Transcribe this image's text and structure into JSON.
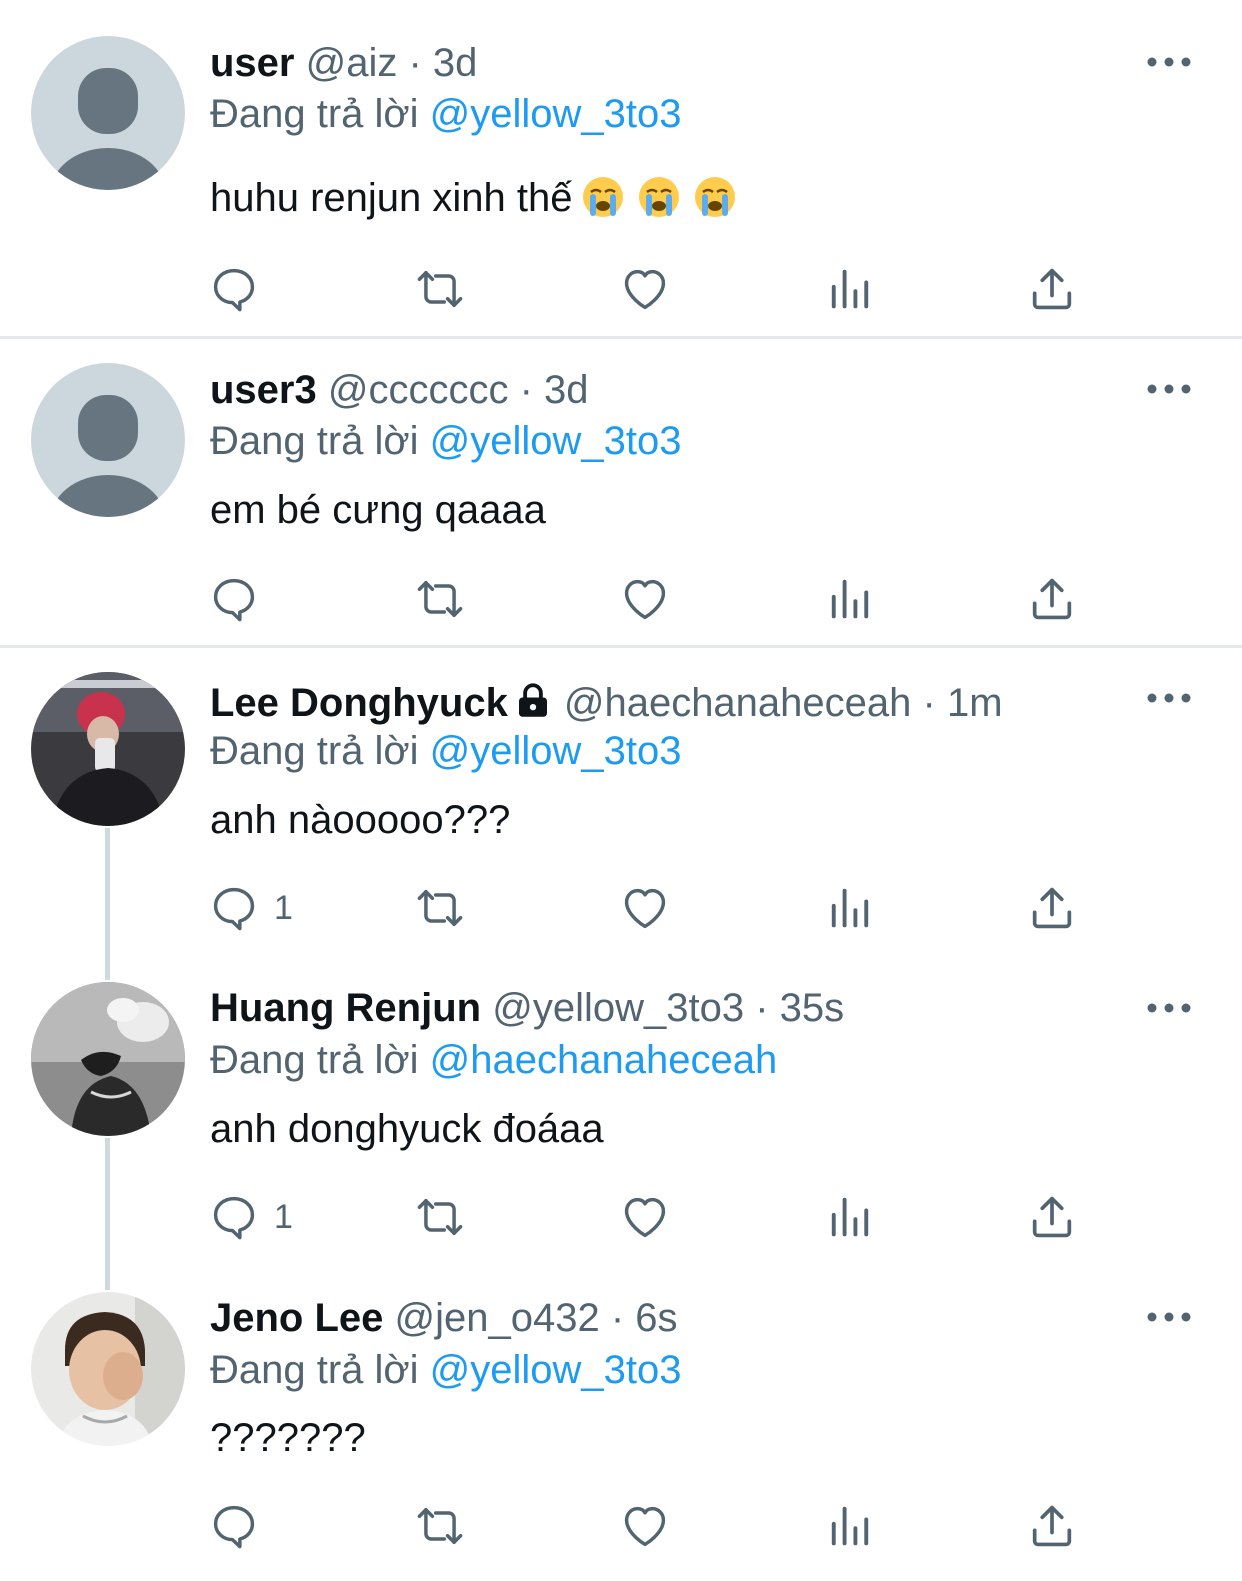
{
  "colors": {
    "accent": "#1d9bf0",
    "secondary_text": "#536471",
    "divider": "#e6e9eb",
    "thread_line": "#cfd9de"
  },
  "tweets": [
    {
      "name": "user",
      "handle": "@aiz",
      "sep": " · ",
      "time": "3d",
      "reply_prefix": "Đang trả lời ",
      "reply_to": "@yellow_3to3",
      "text": "huhu renjun xinh thế",
      "text_emoji": [
        "loudly-crying-face-icon",
        "loudly-crying-face-icon",
        "loudly-crying-face-icon"
      ],
      "reply_count": "",
      "avatar": "default-avatar-icon"
    },
    {
      "name": "user3",
      "handle": "@ccccccc",
      "sep": " · ",
      "time": "3d",
      "reply_prefix": "Đang trả lời ",
      "reply_to": "@yellow_3to3",
      "text": "em bé cưng qaaaa",
      "reply_count": "",
      "avatar": "default-avatar-icon"
    },
    {
      "name": "Lee Donghyuck",
      "protected_icon": "lock-icon",
      "handle": "@haechanaheceah",
      "sep": " · ",
      "time": "1m",
      "reply_prefix": "Đang trả lời ",
      "reply_to": "@yellow_3to3",
      "text": "anh nàooooo???",
      "reply_count": "1",
      "avatar": "profile-photo"
    },
    {
      "name": "Huang Renjun",
      "handle": "@yellow_3to3",
      "sep": " · ",
      "time": "35s",
      "reply_prefix": "Đang trả lời ",
      "reply_to": "@haechanaheceah",
      "text": "anh donghyuck đoáaa",
      "reply_count": "1",
      "avatar": "profile-photo"
    },
    {
      "name": "Jeno Lee",
      "handle": "@jen_o432",
      "sep": " · ",
      "time": "6s",
      "reply_prefix": "Đang trả lời ",
      "reply_to": "@yellow_3to3",
      "text": "???????",
      "reply_count": "",
      "avatar": "profile-photo"
    }
  ]
}
